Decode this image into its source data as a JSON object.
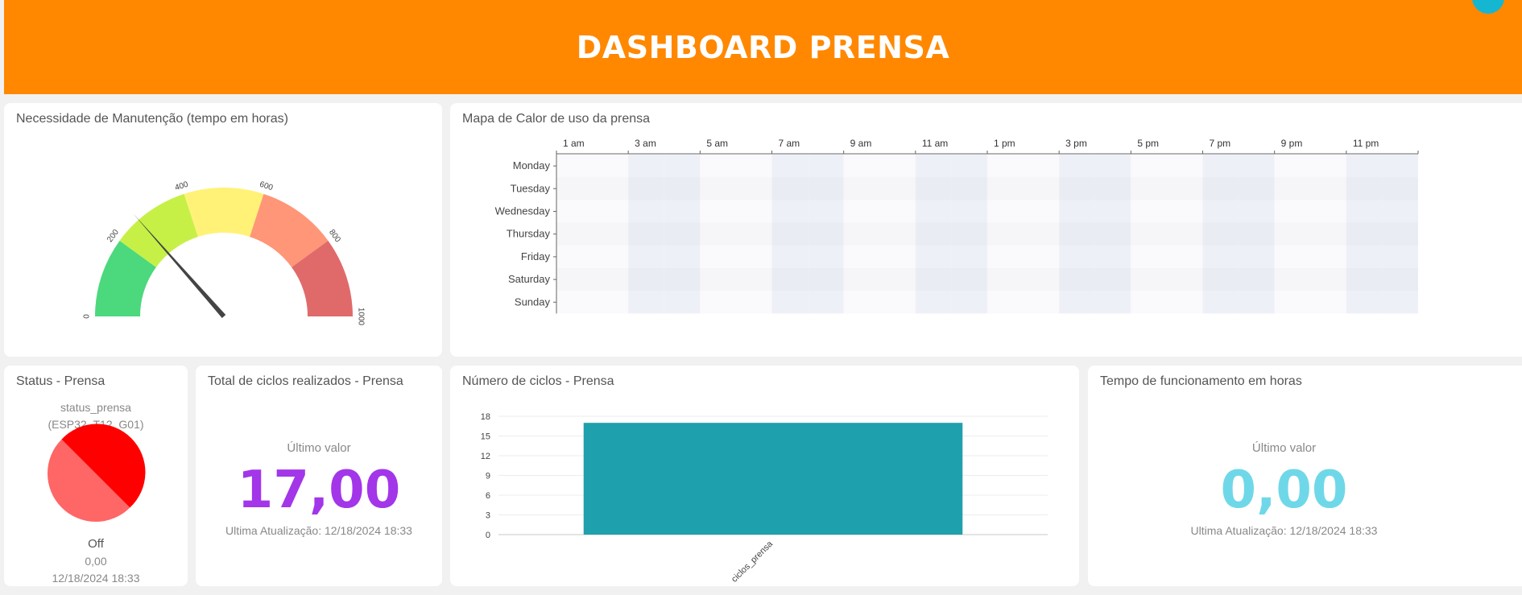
{
  "header": {
    "title": "DASHBOARD PRENSA"
  },
  "colors": {
    "header_bg": "#ff8800",
    "fab": "#15b6d2",
    "bar": "#1fa0ad",
    "total_value": "#a336e8",
    "tempo_value": "#6fd8e8",
    "status_red": "#ff0000",
    "status_light_red": "#ff6666"
  },
  "gauge": {
    "title": "Necessidade de Manutenção (tempo em horas)",
    "min": 0,
    "max": 1000,
    "value": 270,
    "tick_labels": [
      "0",
      "200",
      "400",
      "600",
      "800",
      "1000"
    ],
    "bands": [
      {
        "from": 0,
        "to": 200,
        "color": "#4cd87d"
      },
      {
        "from": 200,
        "to": 400,
        "color": "#c6f046"
      },
      {
        "from": 400,
        "to": 600,
        "color": "#fff277"
      },
      {
        "from": 600,
        "to": 800,
        "color": "#ff9677"
      },
      {
        "from": 800,
        "to": 1000,
        "color": "#e06a6a"
      }
    ]
  },
  "heatmap": {
    "title": "Mapa de Calor de uso da prensa",
    "hour_labels": [
      "1 am",
      "3 am",
      "5 am",
      "7 am",
      "9 am",
      "11 am",
      "1 pm",
      "3 pm",
      "5 pm",
      "7 pm",
      "9 pm",
      "11 pm"
    ],
    "days": [
      "Monday",
      "Tuesday",
      "Wednesday",
      "Thursday",
      "Friday",
      "Saturday",
      "Sunday"
    ]
  },
  "status": {
    "title": "Status - Prensa",
    "variable": "status_prensa",
    "device": "(ESP32_T12_G01)",
    "state": "Off",
    "value": "0,00",
    "timestamp": "12/18/2024 18:33",
    "icon": "status-pie-icon"
  },
  "total": {
    "title": "Total de ciclos realizados - Prensa",
    "label": "Último valor",
    "value": "17,00",
    "updated": "Ultima Atualização: 12/18/2024 18:33"
  },
  "ciclos": {
    "title": "Número de ciclos - Prensa"
  },
  "chart_data": {
    "type": "bar",
    "categories": [
      "ciclos_prensa"
    ],
    "values": [
      17
    ],
    "y_ticks": [
      "0",
      "3",
      "6",
      "9",
      "12",
      "15",
      "18"
    ],
    "ylim": [
      0,
      18
    ],
    "grid": true
  },
  "tempo": {
    "title": "Tempo de funcionamento em horas",
    "label": "Último valor",
    "value": "0,00",
    "updated": "Ultima Atualização: 12/18/2024 18:33"
  }
}
